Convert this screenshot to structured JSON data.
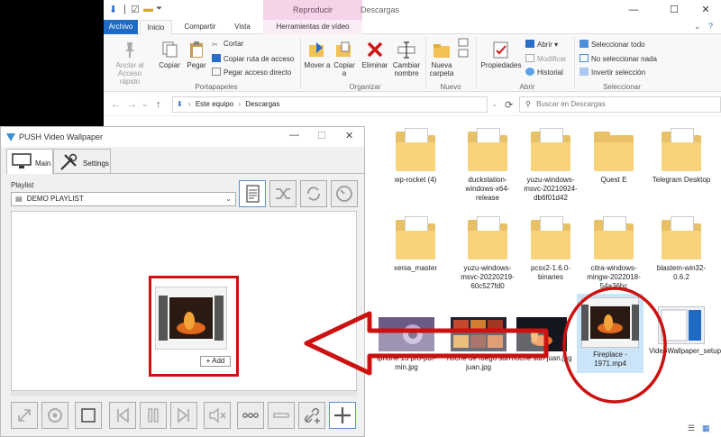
{
  "explorer": {
    "title": "Descargas",
    "context_group": "Reproducir",
    "tabs": [
      "Archivo",
      "Inicio",
      "Compartir",
      "Vista",
      "Herramientas de vídeo"
    ],
    "ribbon": {
      "portapapeles": {
        "label": "Portapapeles",
        "anclar": "Anclar al Acceso rápido",
        "copiar": "Copiar",
        "pegar": "Pegar",
        "cortar": "Cortar",
        "copiar_ruta": "Copiar ruta de acceso",
        "pegar_acceso": "Pegar acceso directo"
      },
      "organizar": {
        "label": "Organizar",
        "mover": "Mover a",
        "copiar_a": "Copiar a",
        "eliminar": "Eliminar",
        "cambiar": "Cambiar nombre"
      },
      "nuevo": {
        "label": "Nuevo",
        "nueva_carpeta": "Nueva carpeta"
      },
      "abrir": {
        "label": "Abrir",
        "propiedades": "Propiedades",
        "abrir": "Abrir",
        "modificar": "Modificar",
        "historial": "Historial"
      },
      "seleccionar": {
        "label": "Seleccionar",
        "todo": "Seleccionar todo",
        "nada": "No seleccionar nada",
        "invertir": "Invertir selección"
      }
    },
    "address": {
      "root": "Este equipo",
      "folder": "Descargas"
    },
    "search_placeholder": "Buscar en Descargas",
    "files": {
      "wp_rocket": "wp-rocket (4)",
      "duckstation": "duckstation-windows-x64-release",
      "yuzu1": "yuzu-windows-msvc-20210924-db6f01d42",
      "quest": "Quest E",
      "telegram": "Telegram Desktop",
      "xenia": "xenia_master",
      "yuzu2": "yuzu-windows-msvc-20220219-60c527fd0",
      "pcsx2": "pcsx2-1.6.0-binaries",
      "citra": "citra-windows-mingw-2022018-54a36bc",
      "blastem": "blastem-win32-0.6.2",
      "iphone": "iphone 13 pro-pdf-min.jpg",
      "noche1": "noche de fuego san juan.jpg",
      "noche2": "noche san juan.jpg",
      "fireplace": "Fireplace - 1971.mp4",
      "setup": "VideoWallpaper_setup.exe"
    }
  },
  "push": {
    "title": "PUSH Video Wallpaper",
    "tab_main": "Main",
    "tab_settings": "Settings",
    "playlist_label": "Playlist",
    "playlist_value": "DEMO PLAYLIST",
    "add_label": "Add"
  },
  "colors": {
    "accent": "#1f6bc4",
    "annotation": "#cc1111",
    "folder": "#e8c065"
  }
}
